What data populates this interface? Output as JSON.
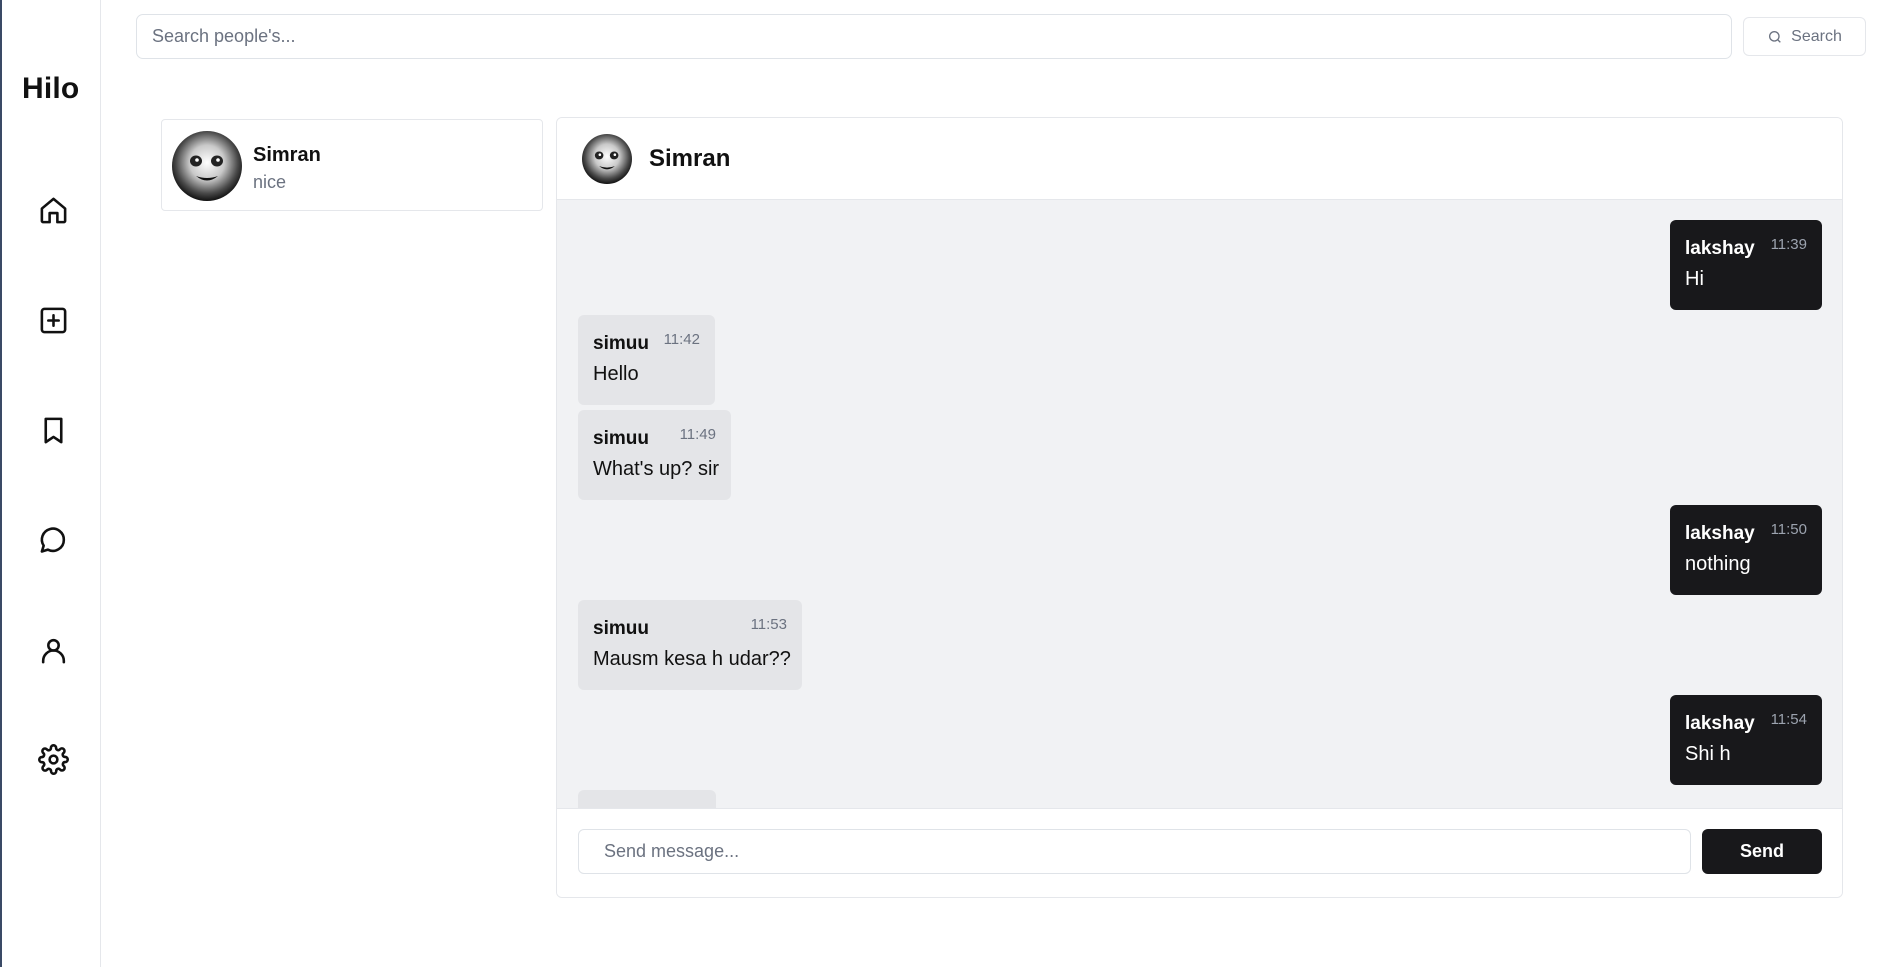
{
  "app": {
    "name": "Hilo"
  },
  "sidebar": {
    "items": [
      {
        "name": "home-icon"
      },
      {
        "name": "plus-square-icon"
      },
      {
        "name": "bookmark-icon"
      },
      {
        "name": "message-circle-icon"
      },
      {
        "name": "user-icon"
      },
      {
        "name": "settings-gear-icon"
      }
    ]
  },
  "search": {
    "placeholder": "Search people's...",
    "value": "",
    "button_label": "Search",
    "button_icon": "search-icon"
  },
  "conversations": [
    {
      "name": "Simran",
      "preview": "nice",
      "avatar": "avatar"
    }
  ],
  "chat": {
    "title": "Simran",
    "messages": [
      {
        "direction": "out",
        "sender": "lakshay",
        "time": "11:39",
        "text": "Hi"
      },
      {
        "direction": "in",
        "sender": "simuu",
        "time": "11:42",
        "text": "Hello"
      },
      {
        "direction": "in",
        "sender": "simuu",
        "time": "11:49",
        "text": "What's up? sir"
      },
      {
        "direction": "out",
        "sender": "lakshay",
        "time": "11:50",
        "text": "nothing"
      },
      {
        "direction": "in",
        "sender": "simuu",
        "time": "11:53",
        "text": "Mausm kesa h udar??"
      },
      {
        "direction": "out",
        "sender": "lakshay",
        "time": "11:54",
        "text": "Shi h"
      }
    ],
    "composer": {
      "placeholder": "Send message...",
      "value": "",
      "send_label": "Send"
    }
  },
  "colors": {
    "primary_dark": "#18181b",
    "incoming_bubble": "#e4e5e8",
    "chat_background": "#f1f2f4",
    "border": "#e5e7eb",
    "muted_text": "#6b7280"
  }
}
